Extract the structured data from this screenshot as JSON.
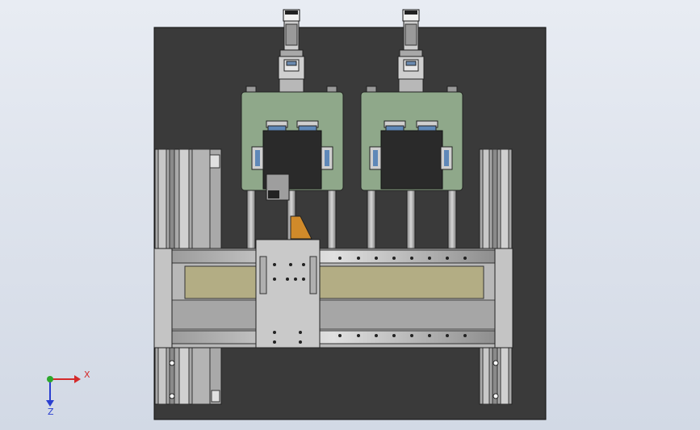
{
  "viewport": {
    "background_top": "#e8ecf3",
    "background_bottom": "#d2d9e5"
  },
  "model": {
    "base_plate_color": "#3a3a3a",
    "frame_color": "#bfbfbf",
    "green_plate_color": "#8fa88a",
    "bed_color": "#b3ad84",
    "accent_orange": "#d08a2a",
    "accent_blue": "#5f88b8"
  },
  "triad": {
    "x_label": "X",
    "z_label": "Z",
    "x_color": "#d42a2a",
    "y_color": "#2ca82c",
    "z_color": "#2a3fd0"
  }
}
